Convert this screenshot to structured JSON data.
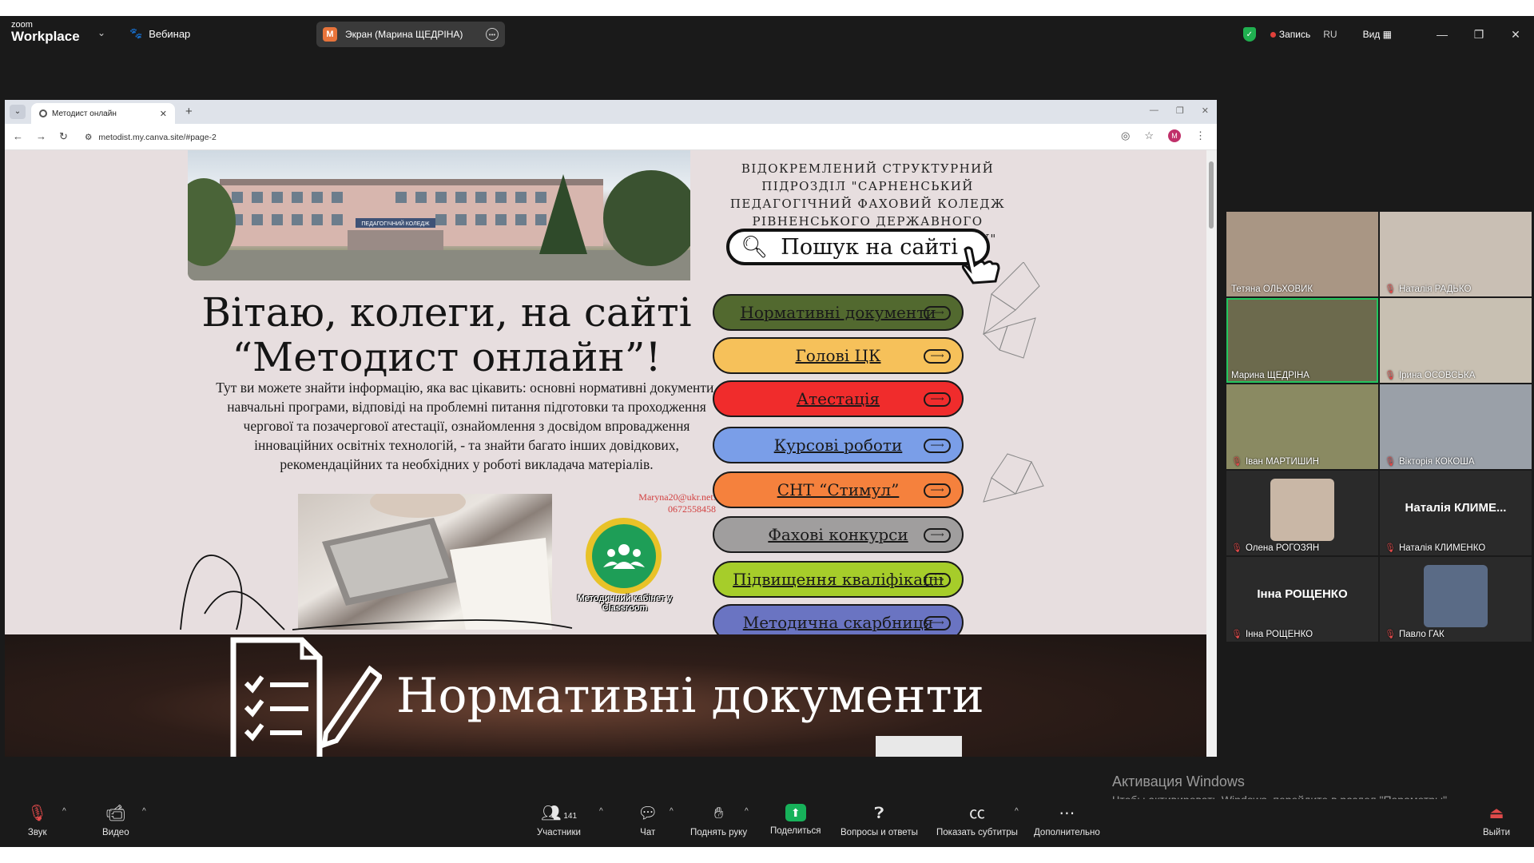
{
  "zoom": {
    "logo_small": "zoom",
    "logo_big": "Workplace",
    "webinar": "Вебинар",
    "share_initial": "M",
    "share_label": "Экран (Марина ЩЕДРІНА)",
    "record": "Запись",
    "lang": "RU",
    "view": "Вид"
  },
  "browser": {
    "tab_title": "Методист онлайн",
    "url": "metodist.my.canva.site/#page-2",
    "profile_initial": "M"
  },
  "site": {
    "college_title": "ВІДОКРЕМЛЕНИЙ СТРУКТУРНИЙ ПІДРОЗДІЛ \"САРНЕНСЬКИЙ ПЕДАГОГІЧНИЙ ФАХОВИЙ КОЛЕДЖ РІВНЕНСЬКОГО ДЕРЖАВНОГО ГУМАНІТАРНОГО УНІВЕРСИТЕТУ\"",
    "search_label": "Пошук на сайті",
    "welcome_line1": "Вітаю, колеги, на сайті",
    "welcome_line2": "“Методист онлайн”!",
    "description": "Тут ви можете знайти інформацію, яка вас цікавить: основні нормативні документи, навчальні програми, відповіді на проблемні питання підготовки та проходження чергової та позачергової атестації, ознайомлення з досвідом впровадження інноваційних освітніх технологій, - та знайти багато інших довідкових, рекомендаційних та необхідних у роботі викладача матеріалів.",
    "contact_email": "Maryna20@ukr.net:",
    "contact_phone": "0672558458",
    "classroom_label": "Методичний кабінет у Classroom",
    "building_sign": "ПЕДАГОГІЧНИЙ КОЛЕДЖ",
    "menu": [
      {
        "label": "Нормативні документи",
        "color": "#52692f"
      },
      {
        "label": "Голові ЦК",
        "color": "#f6c15a"
      },
      {
        "label": "Атестація",
        "color": "#f02c2c"
      },
      {
        "label": "Курсові роботи",
        "color": "#7a9ee8"
      },
      {
        "label": "СНТ “Стимул”",
        "color": "#f5813d"
      },
      {
        "label": "Фахові конкурси",
        "color": "#a09e9e"
      },
      {
        "label": "Підвищення кваліфікації",
        "color": "#a6cd2a"
      },
      {
        "label": "Методична скарбниця",
        "color": "#6a74c2"
      }
    ],
    "section_title": "Нормативні документи"
  },
  "participants": [
    {
      "name": "Тетяна ОЛЬХОВИК",
      "muted": false,
      "bg": "#a99684",
      "active": false
    },
    {
      "name": "Наталія РАДЬКО",
      "muted": true,
      "bg": "#c9bfb4",
      "active": false
    },
    {
      "name": "Марина ЩЕДРІНА",
      "muted": false,
      "bg": "#6c6a4d",
      "active": true
    },
    {
      "name": "Ірина ОСОВСЬКА",
      "muted": true,
      "bg": "#c8c0b2",
      "active": false
    },
    {
      "name": "Іван МАРТИШИН",
      "muted": true,
      "bg": "#8a8a62",
      "active": false
    },
    {
      "name": "Вікторія КОКОША",
      "muted": true,
      "bg": "#9aa0a8",
      "active": false
    },
    {
      "name": "Олена РОГОЗЯН",
      "muted": true,
      "bg": "#2a2a2a",
      "avatar": "#c9b7a6",
      "active": false
    },
    {
      "name": "Наталія КЛИМЕНКО",
      "muted": true,
      "bg": "#2a2a2a",
      "big": "Наталія КЛИМЕ...",
      "active": false
    },
    {
      "name": "Інна РОЩЕНКО",
      "muted": true,
      "bg": "#2a2a2a",
      "big": "Інна РОЩЕНКО",
      "active": false
    },
    {
      "name": "Павло ГАК",
      "muted": true,
      "bg": "#2a2a2a",
      "avatar": "#5a6b86",
      "active": false
    }
  ],
  "toolbar": {
    "audio": "Звук",
    "video": "Видео",
    "participants": "Участники",
    "participants_count": "141",
    "chat": "Чат",
    "raise_hand": "Поднять руку",
    "share": "Поделиться",
    "qa": "Вопросы и ответы",
    "captions": "Показать субтитры",
    "more": "Дополнительно",
    "leave": "Выйти"
  },
  "activation": {
    "title": "Активация Windows",
    "subtitle": "Чтобы активировать Windows, перейдите в раздел \"Параметры\"."
  }
}
